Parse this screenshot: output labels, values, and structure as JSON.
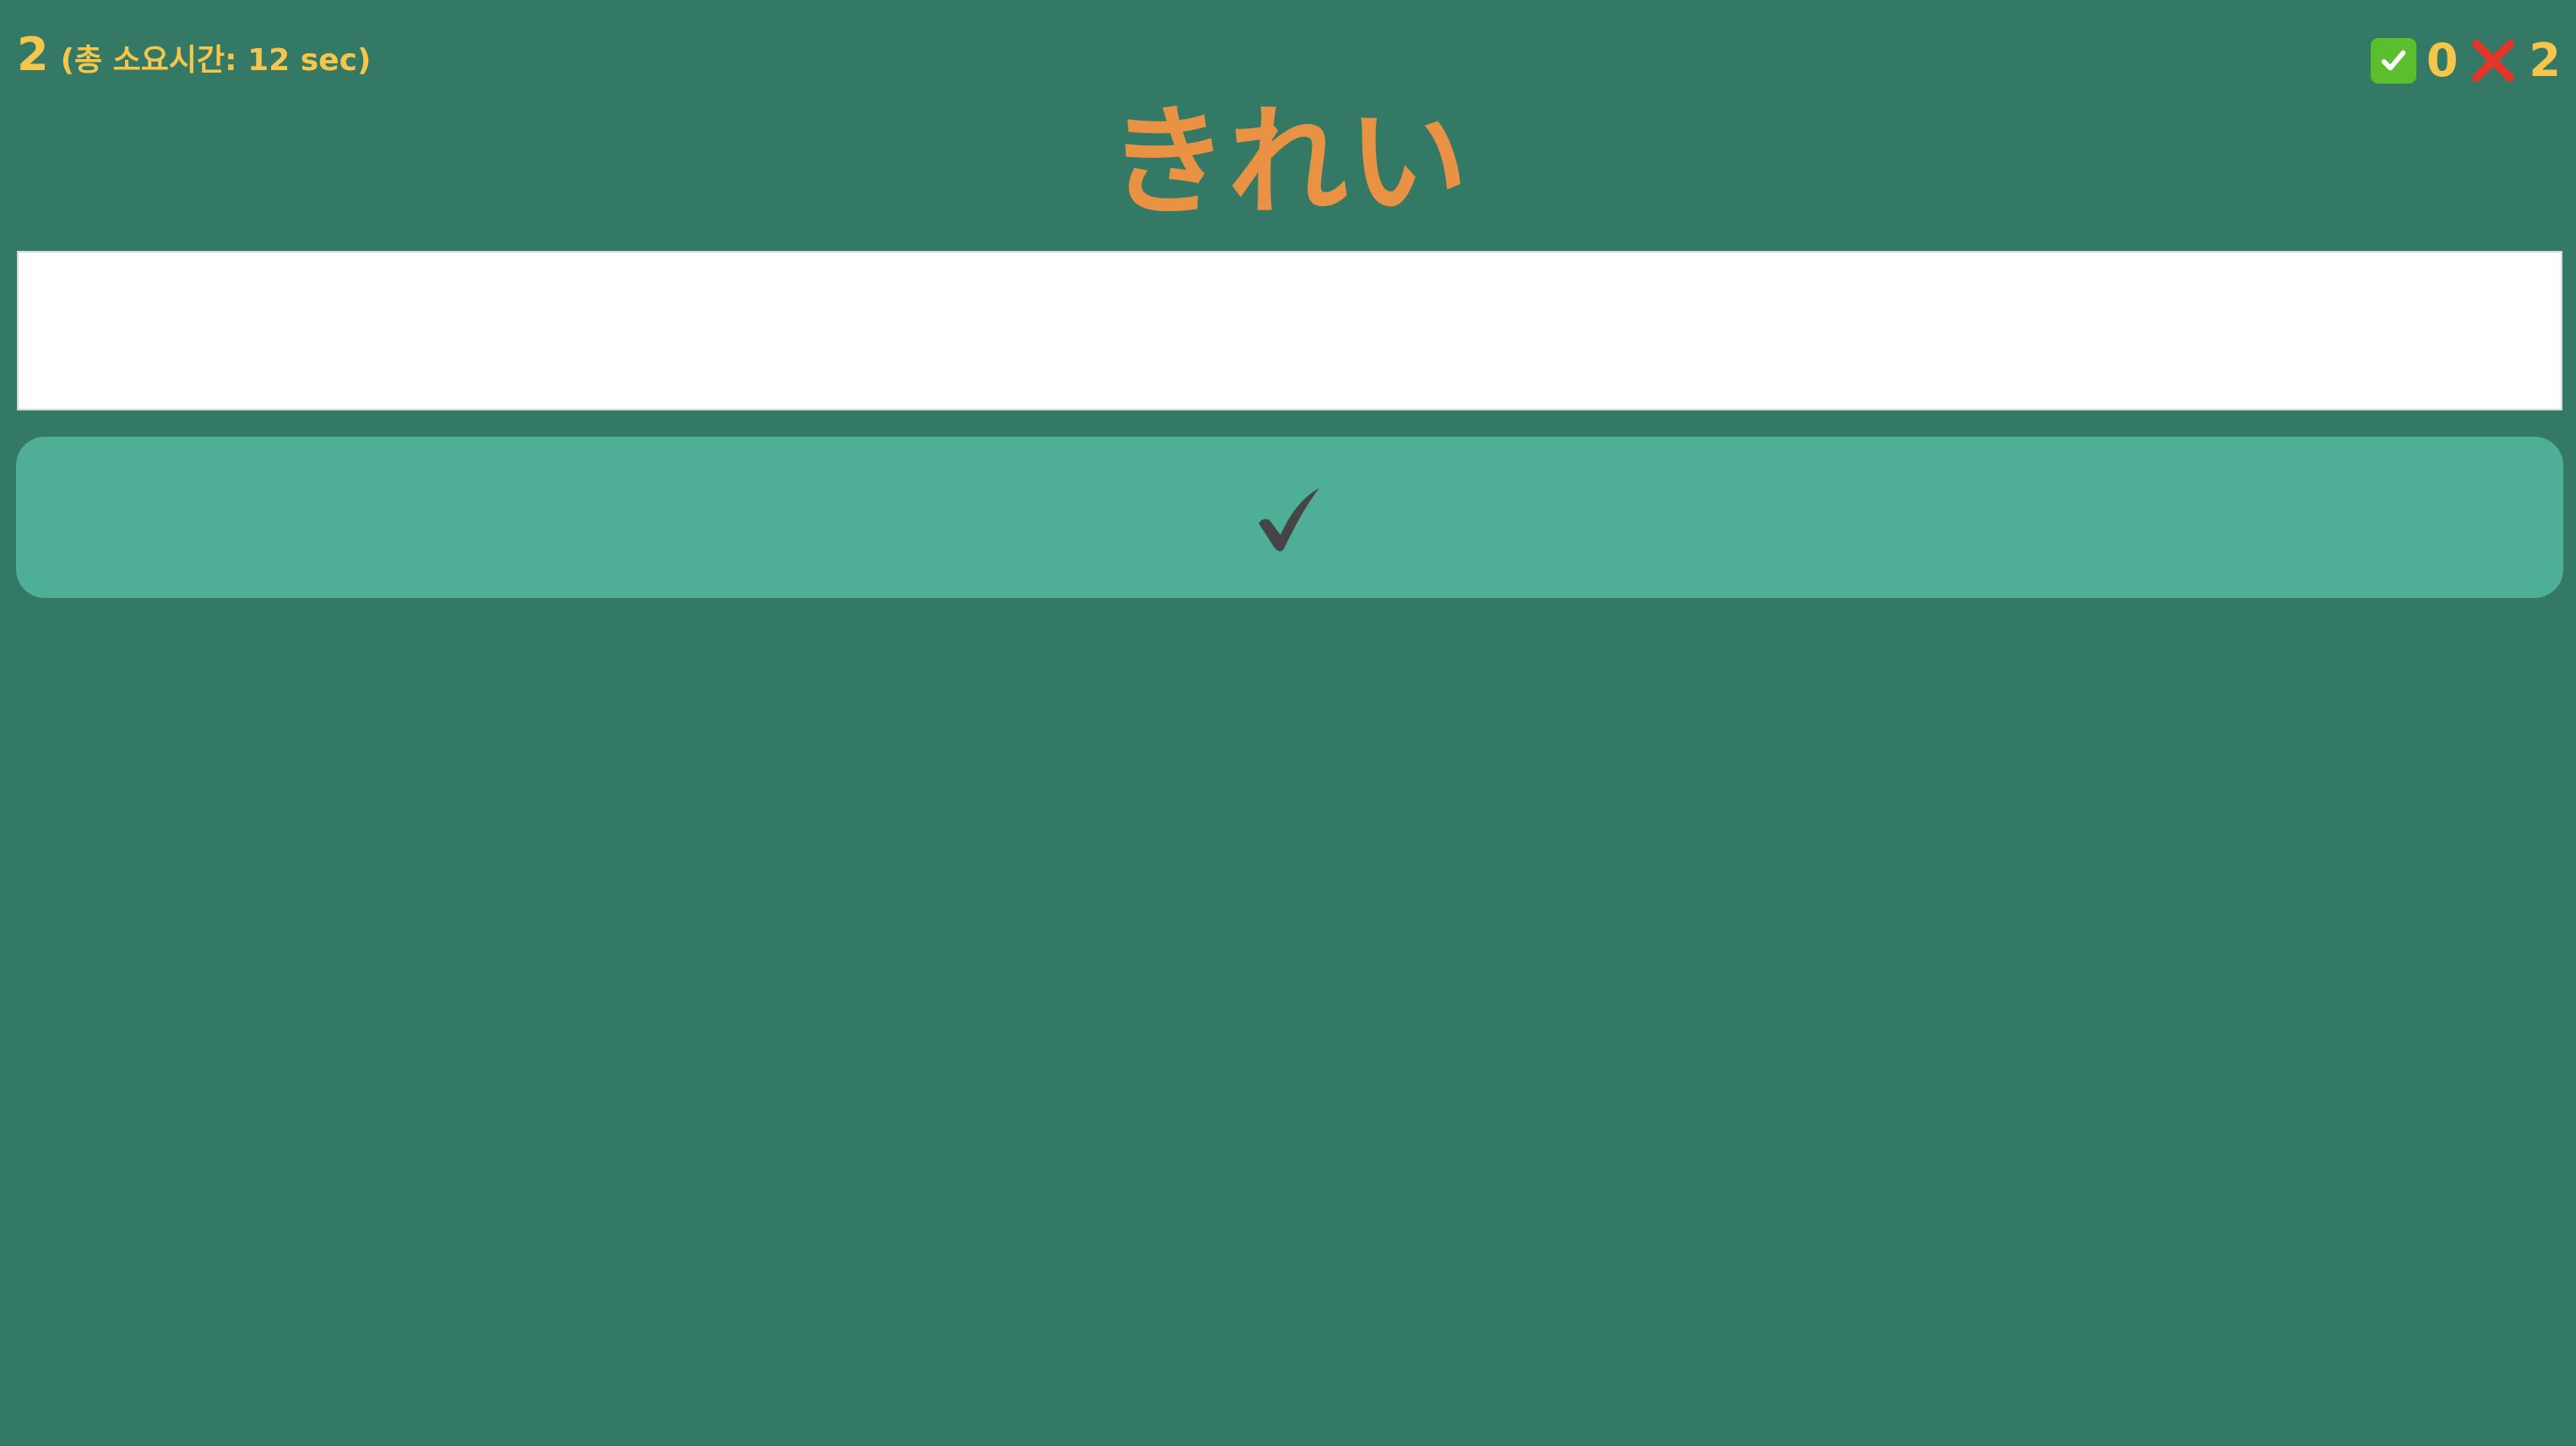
{
  "status": {
    "question_number": "2",
    "elapsed_time": "(총 소요시간: 12 sec)"
  },
  "score": {
    "correct_icon": "green-check-icon",
    "correct_count": "0",
    "wrong_icon": "red-cross-icon",
    "wrong_count": "2"
  },
  "quiz": {
    "word": "きれい",
    "answer_value": "",
    "submit_icon": "checkmark-icon"
  },
  "colors": {
    "background": "#347866",
    "accent_yellow": "#f6c64b",
    "word_orange": "#e99244",
    "button_teal": "#4fae96",
    "check_dark": "#454545",
    "correct_green": "#5bbf2d",
    "wrong_red": "#e5352b"
  }
}
